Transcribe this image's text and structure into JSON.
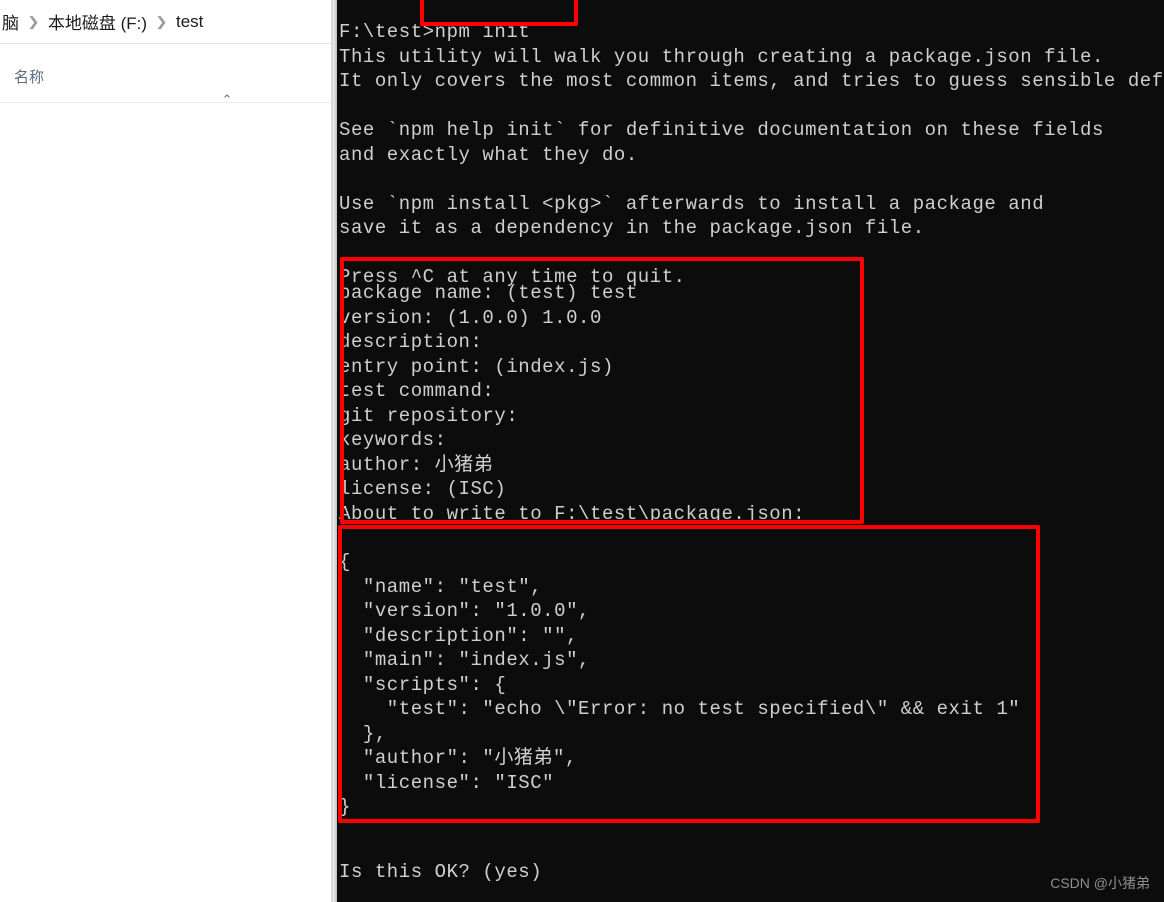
{
  "explorer": {
    "breadcrumb": {
      "items": [
        "脑",
        "本地磁盘 (F:)",
        "test"
      ],
      "separator": "❯"
    },
    "columns": [
      {
        "label": "名称",
        "sort_indicator": "⌃"
      }
    ]
  },
  "terminal": {
    "background_color": "#0c0c0c",
    "text_color": "#cfcfcf",
    "prompt_path": "F:\\test>",
    "command": "npm init",
    "intro_block": "F:\\test>npm init\nThis utility will walk you through creating a package.json file.\nIt only covers the most common items, and tries to guess sensible def\n\nSee `npm help init` for definitive documentation on these fields\nand exactly what they do.\n\nUse `npm install <pkg>` afterwards to install a package and\nsave it as a dependency in the package.json file.\n\nPress ^C at any time to quit.",
    "prompt_block": "package name: (test) test\nversion: (1.0.0) 1.0.0\ndescription:\nentry point: (index.js)\ntest command:\ngit repository:\nkeywords:\nauthor: 小猪弟\nlicense: (ISC)\nAbout to write to F:\\test\\package.json:",
    "json_block": "{\n  \"name\": \"test\",\n  \"version\": \"1.0.0\",\n  \"description\": \"\",\n  \"main\": \"index.js\",\n  \"scripts\": {\n    \"test\": \"echo \\\"Error: no test specified\\\" && exit 1\"\n  },\n  \"author\": \"小猪弟\",\n  \"license\": \"ISC\"\n}",
    "tail_block": "Is this OK? (yes)",
    "prompt_answers": {
      "package_name_default": "(test)",
      "package_name_value": "test",
      "version_default": "(1.0.0)",
      "version_value": "1.0.0",
      "description_value": "",
      "entry_point_default": "(index.js)",
      "test_command_value": "",
      "git_repository_value": "",
      "keywords_value": "",
      "author_value": "小猪弟",
      "license_default": "(ISC)",
      "target_path": "F:\\test\\package.json"
    },
    "package_json": {
      "name": "test",
      "version": "1.0.0",
      "description": "",
      "main": "index.js",
      "scripts": {
        "test": "echo \"Error: no test specified\" && exit 1"
      },
      "author": "小猪弟",
      "license": "ISC"
    }
  },
  "annotations": {
    "highlight_color": "#fe0000",
    "boxes": [
      {
        "name": "npm-init-command",
        "target": "npm init"
      },
      {
        "name": "init-prompt-answers",
        "target": "package name … About to write to F:\\test\\package.json:"
      },
      {
        "name": "generated-package-json",
        "target": "{ \"name\": \"test\" … }"
      }
    ]
  },
  "watermark": {
    "text": "CSDN @小猪弟"
  }
}
